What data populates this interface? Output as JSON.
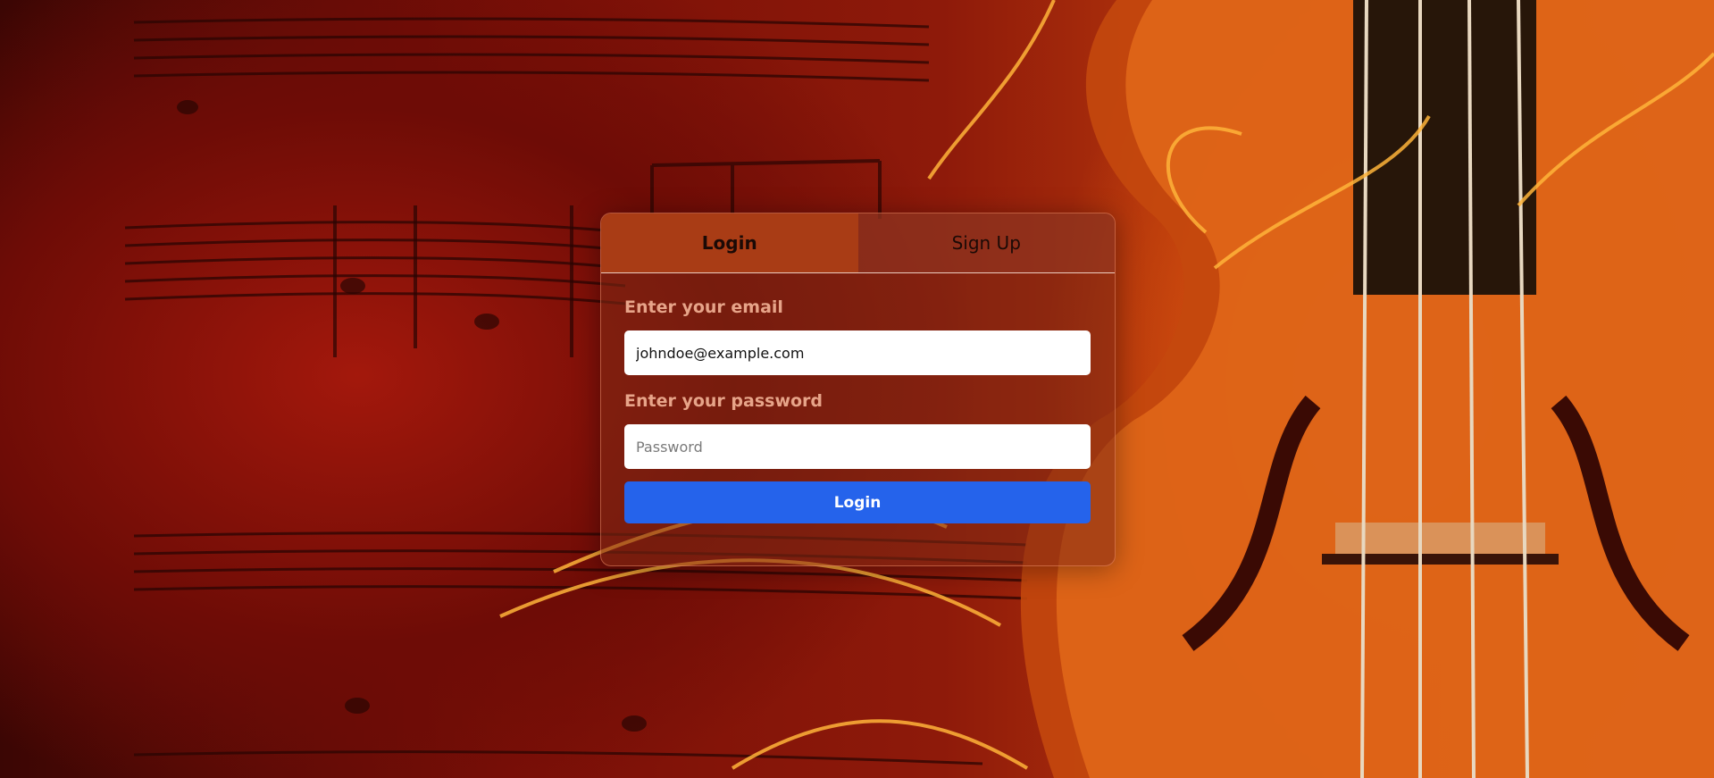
{
  "tabs": {
    "login_label": "Login",
    "signup_label": "Sign Up"
  },
  "form": {
    "email_label": "Enter your email",
    "email_value": "johndoe@example.com",
    "password_label": "Enter your password",
    "password_placeholder": "Password",
    "submit_label": "Login"
  },
  "colors": {
    "accent": "#2563eb",
    "active_tab": "#a93c15",
    "label": "#e7a489"
  },
  "background": {
    "icon": "violin-and-sheet-music-image"
  }
}
